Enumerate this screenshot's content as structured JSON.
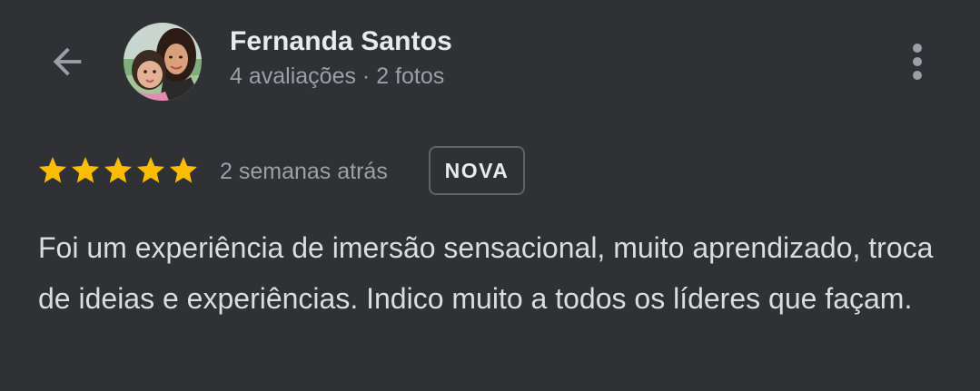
{
  "header": {
    "reviewer_name": "Fernanda Santos",
    "reviewer_meta": "4 avaliações · 2 fotos",
    "back_icon": "arrow-left-icon",
    "more_icon": "more-vert-icon"
  },
  "review": {
    "rating": 5,
    "max_rating": 5,
    "time_ago": "2 semanas atrás",
    "badge": "NOVA",
    "text": "Foi um experiência de imersão sensacional, muito aprendizado, troca de ideias e experiências. Indico muito a todos os líderes que façam."
  },
  "colors": {
    "background": "#303134",
    "star": "#fbbc04",
    "primary_text": "#e8eaed",
    "secondary_text": "#9aa0a6"
  }
}
